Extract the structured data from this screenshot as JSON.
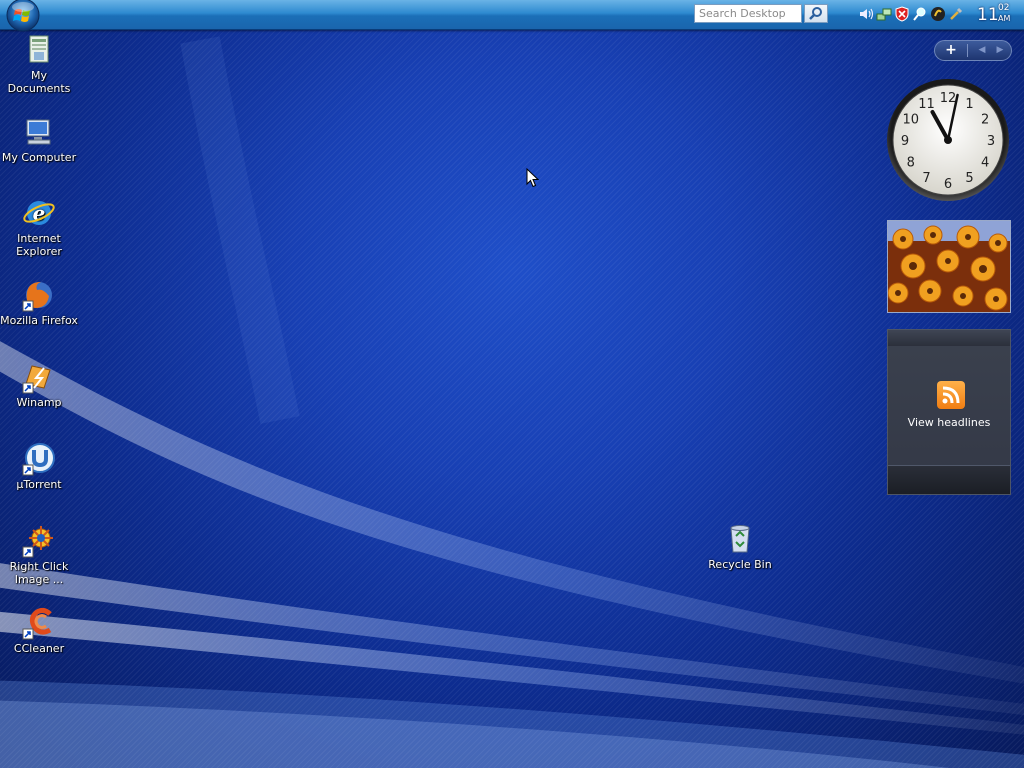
{
  "taskbar": {
    "search_placeholder": "Search Desktop",
    "clock": {
      "hour": "11",
      "minute": "02",
      "ampm": "AM"
    },
    "tray_icons": [
      "volume-icon",
      "network-icon",
      "security-alert-icon",
      "search-tray-icon",
      "app-tray-icon",
      "tools-icon"
    ]
  },
  "desktop_icons": [
    {
      "label": "My Documents",
      "icon": "my-documents-icon"
    },
    {
      "label": "My Computer",
      "icon": "my-computer-icon"
    },
    {
      "label": "Internet Explorer",
      "icon": "internet-explorer-icon"
    },
    {
      "label": "Mozilla Firefox",
      "icon": "firefox-icon"
    },
    {
      "label": "Winamp",
      "icon": "winamp-icon"
    },
    {
      "label": "µTorrent",
      "icon": "utorrent-icon"
    },
    {
      "label": "Right Click Image ...",
      "icon": "right-click-image-icon"
    },
    {
      "label": "CCleaner",
      "icon": "ccleaner-icon"
    },
    {
      "label": "Recycle Bin",
      "icon": "recycle-bin-icon"
    }
  ],
  "sidebar": {
    "add_label": "+",
    "clock_gadget": {
      "hour": 11,
      "minute": 2
    },
    "feed_gadget": {
      "label": "View headlines"
    }
  },
  "colors": {
    "desktop_bg": "#1840b4",
    "taskbar": "#2e8ad0",
    "rss": "#f07d12"
  }
}
